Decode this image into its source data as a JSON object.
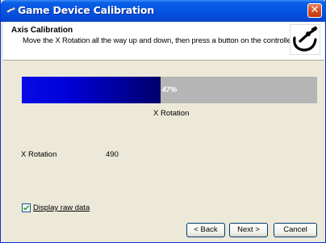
{
  "window": {
    "title": "Game Device Calibration",
    "close_glyph": "✕"
  },
  "header": {
    "title": "Axis Calibration",
    "subtitle": "Move the X Rotation all the way up and down, then press a button on the controller.",
    "icon": "joystick-icon"
  },
  "progress": {
    "label": "47%",
    "value": 0.47,
    "caption": "X Rotation"
  },
  "raw_data": {
    "axis_label": "X Rotation",
    "axis_value": "490"
  },
  "checkbox": {
    "label": "Display raw data",
    "checked": true
  },
  "buttons": {
    "back": "< Back",
    "next": "Next >",
    "cancel": "Cancel"
  },
  "colors": {
    "progress_fill": "#0000c0",
    "progress_track": "#b5b5b5",
    "titlebar": "#0454e3"
  }
}
